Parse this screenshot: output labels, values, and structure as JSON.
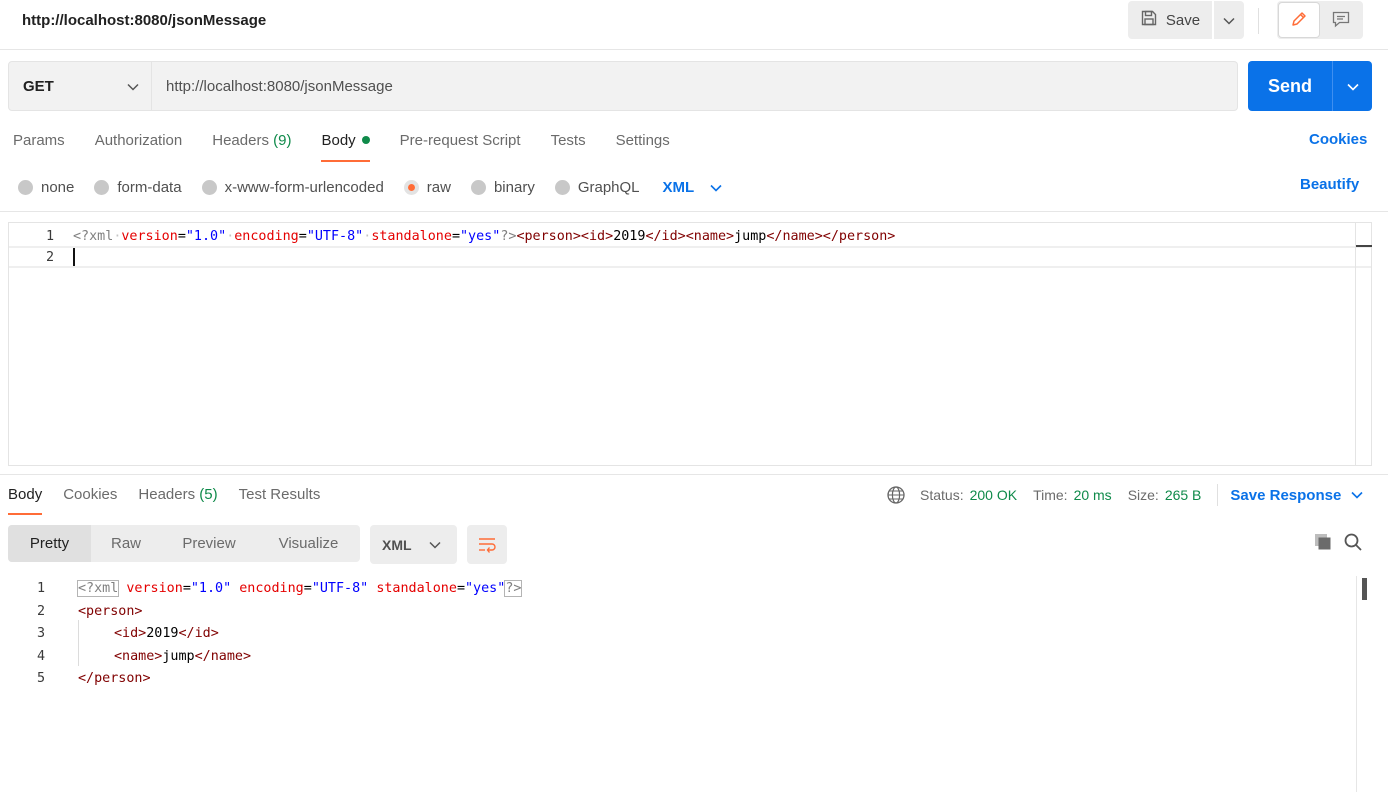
{
  "header": {
    "title": "http://localhost:8080/jsonMessage",
    "save_label": "Save"
  },
  "request": {
    "method": "GET",
    "url": "http://localhost:8080/jsonMessage",
    "send_label": "Send"
  },
  "tabs": {
    "params": "Params",
    "authorization": "Authorization",
    "headers": "Headers",
    "headers_count": "(9)",
    "body": "Body",
    "prerequest": "Pre-request Script",
    "tests": "Tests",
    "settings": "Settings",
    "cookies": "Cookies"
  },
  "body_types": {
    "none": "none",
    "form_data": "form-data",
    "urlencoded": "x-www-form-urlencoded",
    "raw": "raw",
    "binary": "binary",
    "graphql": "GraphQL",
    "selected": "raw",
    "format": "XML",
    "beautify": "Beautify"
  },
  "request_editor": {
    "line_numbers": [
      "1",
      "2"
    ],
    "line1": {
      "pi_open": "<?",
      "pi_name": "xml",
      "attr1": "version",
      "val1": "\"1.0\"",
      "attr2": "encoding",
      "val2": "\"UTF-8\"",
      "attr3": "standalone",
      "val3": "\"yes\"",
      "pi_close": "?>",
      "tags": "<person><id>",
      "id_value": "2019",
      "mid": "</id><name>",
      "name_value": "jump",
      "end": "</name></person>"
    },
    "eq": "=",
    "whitespace_dot": "·"
  },
  "response": {
    "tabs": {
      "body": "Body",
      "cookies": "Cookies",
      "headers": "Headers",
      "headers_count": "(5)",
      "test_results": "Test Results"
    },
    "status_label": "Status:",
    "status_value": "200 OK",
    "time_label": "Time:",
    "time_value": "20 ms",
    "size_label": "Size:",
    "size_value": "265 B",
    "save_response": "Save Response",
    "views": {
      "pretty": "Pretty",
      "raw": "Raw",
      "preview": "Preview",
      "visualize": "Visualize"
    },
    "format": "XML",
    "line_numbers": [
      "1",
      "2",
      "3",
      "4",
      "5"
    ],
    "lines": {
      "l1_pi": "<?xml",
      "l1_a1": "version",
      "l1_v1": "\"1.0\"",
      "l1_a2": "encoding",
      "l1_v2": "\"UTF-8\"",
      "l1_a3": "standalone",
      "l1_v3": "\"yes\"",
      "l1_end": "?>",
      "l2": "<person>",
      "l3_open": "<id>",
      "l3_val": "2019",
      "l3_close": "</id>",
      "l4_open": "<name>",
      "l4_val": "jump",
      "l4_close": "</name>",
      "l5": "</person>"
    }
  },
  "colors": {
    "accent_orange": "#ff6c37",
    "primary_blue": "#0a72e8",
    "success_green": "#0f8a4a"
  },
  "icons": {
    "save": "save-icon",
    "caret": "chevron-down-icon",
    "edit": "pencil-icon",
    "comments": "comment-icon",
    "globe": "globe-icon",
    "wrap": "wrap-lines-icon",
    "copy": "copy-icon",
    "search": "search-icon"
  }
}
